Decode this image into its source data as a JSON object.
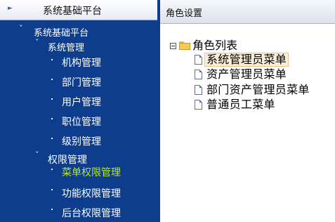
{
  "sidebar": {
    "header_title": "系统基础平台",
    "root_label": "系统基础平台",
    "groups": [
      {
        "label": "系统管理",
        "items": [
          "机构管理",
          "部门管理",
          "用户管理",
          "职位管理",
          "级别管理"
        ]
      },
      {
        "label": "权限管理",
        "items": [
          "菜单权限管理",
          "功能权限管理",
          "后台权限管理"
        ],
        "active_item": "菜单权限管理"
      }
    ]
  },
  "panel": {
    "title": "角色设置",
    "tree": {
      "root_label": "角色列表",
      "items": [
        "系统管理员菜单",
        "资产管理员菜单",
        "部门资产管理员菜单",
        "普通员工菜单"
      ],
      "selected_item": "系统管理员菜单"
    }
  },
  "colors": {
    "sidebar_bg": "#0d3d8c",
    "active_text": "#b8e82a",
    "selection_bg": "#fbeed6"
  }
}
